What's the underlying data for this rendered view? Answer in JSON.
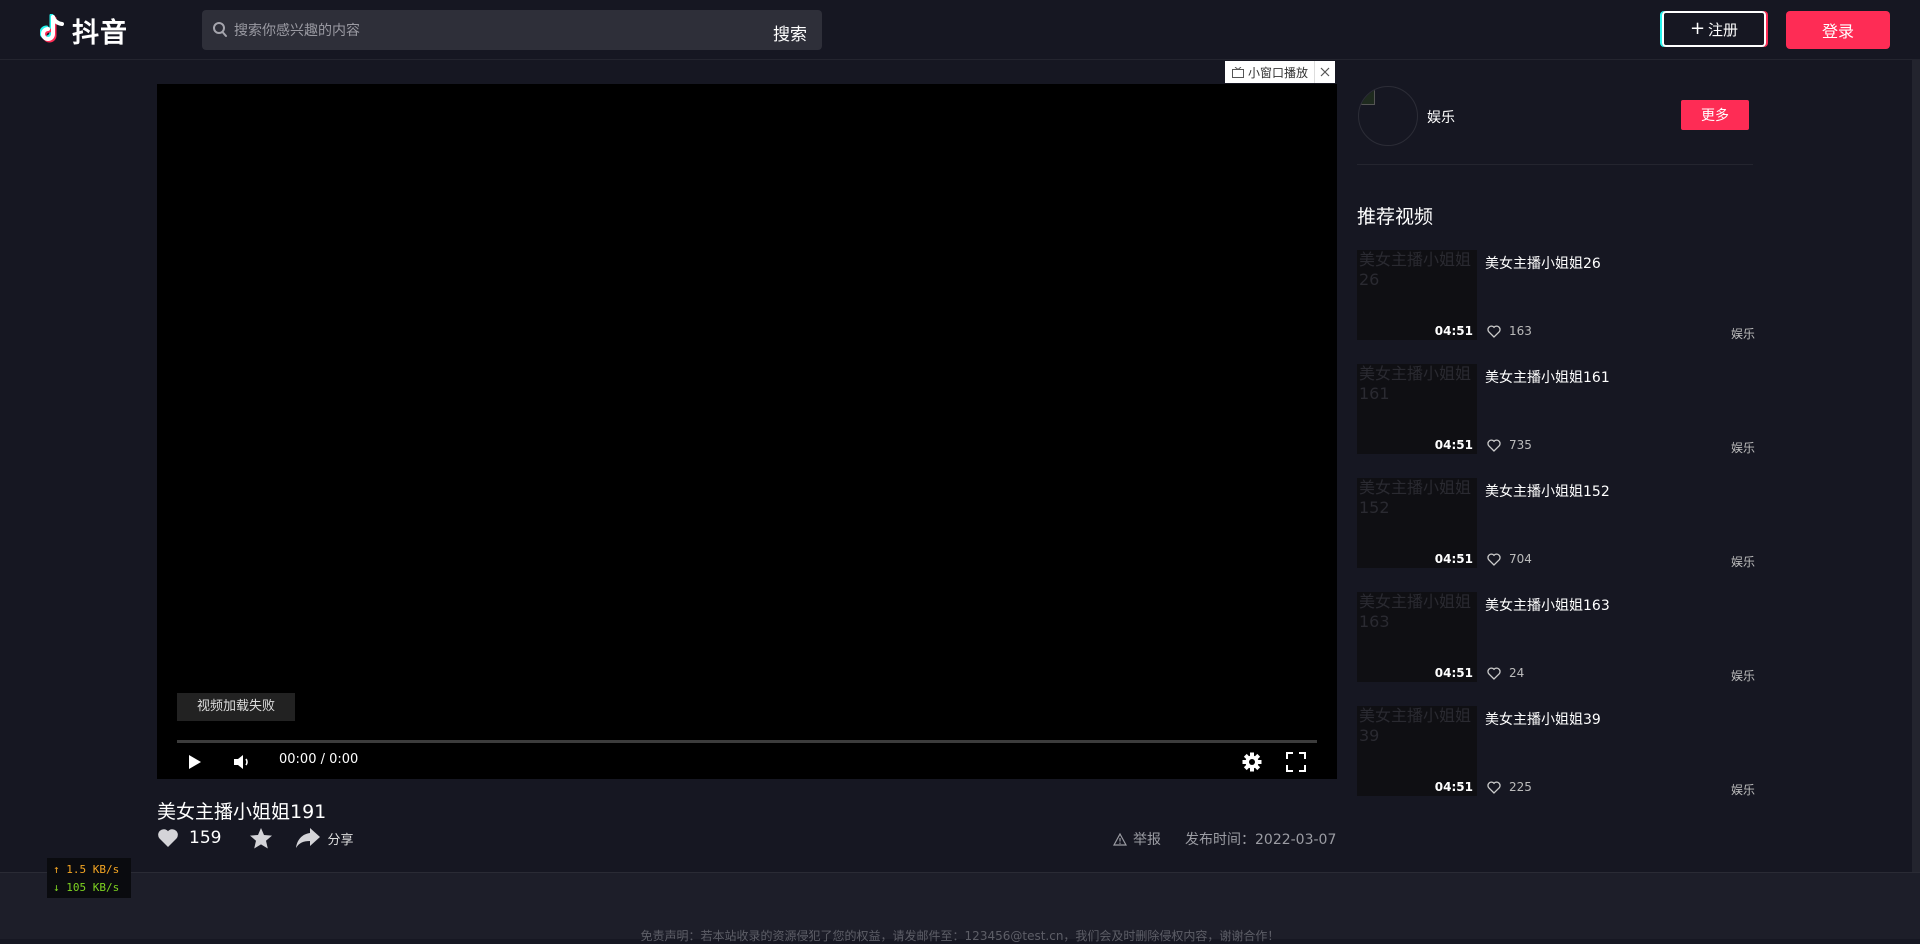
{
  "header": {
    "logo_text": "抖音",
    "search_placeholder": "搜索你感兴趣的内容",
    "search_button": "搜索",
    "register_label": "注册",
    "login_label": "登录"
  },
  "player": {
    "mini_window_label": "小窗口播放",
    "load_error": "视频加载失败",
    "time": "00:00 / 0:00",
    "progress": 0
  },
  "video": {
    "title": "美女主播小姐姐191",
    "likes": "159",
    "share_label": "分享",
    "report_label": "举报",
    "published": "发布时间：2022-03-07"
  },
  "author": {
    "name": "娱乐",
    "more_label": "更多"
  },
  "recommended": {
    "heading": "推荐视频",
    "items": [
      {
        "title": "美女主播小姐姐26",
        "thumb_alt": "美女主播小姐姐26",
        "duration": "04:51",
        "likes": "163",
        "category": "娱乐"
      },
      {
        "title": "美女主播小姐姐161",
        "thumb_alt": "美女主播小姐姐161",
        "duration": "04:51",
        "likes": "735",
        "category": "娱乐"
      },
      {
        "title": "美女主播小姐姐152",
        "thumb_alt": "美女主播小姐姐152",
        "duration": "04:51",
        "likes": "704",
        "category": "娱乐"
      },
      {
        "title": "美女主播小姐姐163",
        "thumb_alt": "美女主播小姐姐163",
        "duration": "04:51",
        "likes": "24",
        "category": "娱乐"
      },
      {
        "title": "美女主播小姐姐39",
        "thumb_alt": "美女主播小姐姐39",
        "duration": "04:51",
        "likes": "225",
        "category": "娱乐"
      }
    ]
  },
  "footer": {
    "disclaimer": "免责声明：若本站收录的资源侵犯了您的权益，请发邮件至：123456@test.cn，我们会及时删除侵权内容，谢谢合作！"
  },
  "net_speed": {
    "up": "↑ 1.5 KB/s",
    "down": "↓ 105 KB/s"
  },
  "colors": {
    "accent": "#fe2c55",
    "background": "#161722",
    "logo_cyan": "#25f4ee"
  }
}
